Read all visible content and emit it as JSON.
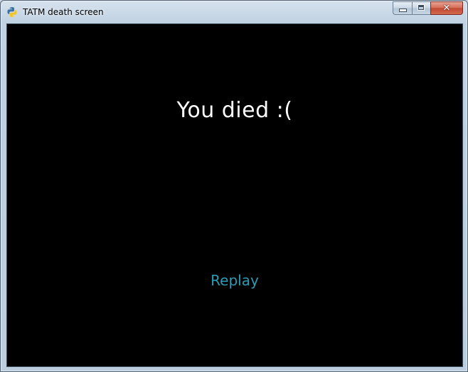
{
  "window": {
    "title": "TATM death screen",
    "app_icon": "python-icon",
    "controls": {
      "minimize_icon": "minimize-icon",
      "maximize_icon": "maximize-icon",
      "close_glyph": "✕"
    }
  },
  "screen": {
    "message": "You died :(",
    "replay_label": "Replay"
  },
  "colors": {
    "background": "#000000",
    "message": "#ffffff",
    "replay": "#2e9bb4",
    "close_button": "#c8503a"
  }
}
